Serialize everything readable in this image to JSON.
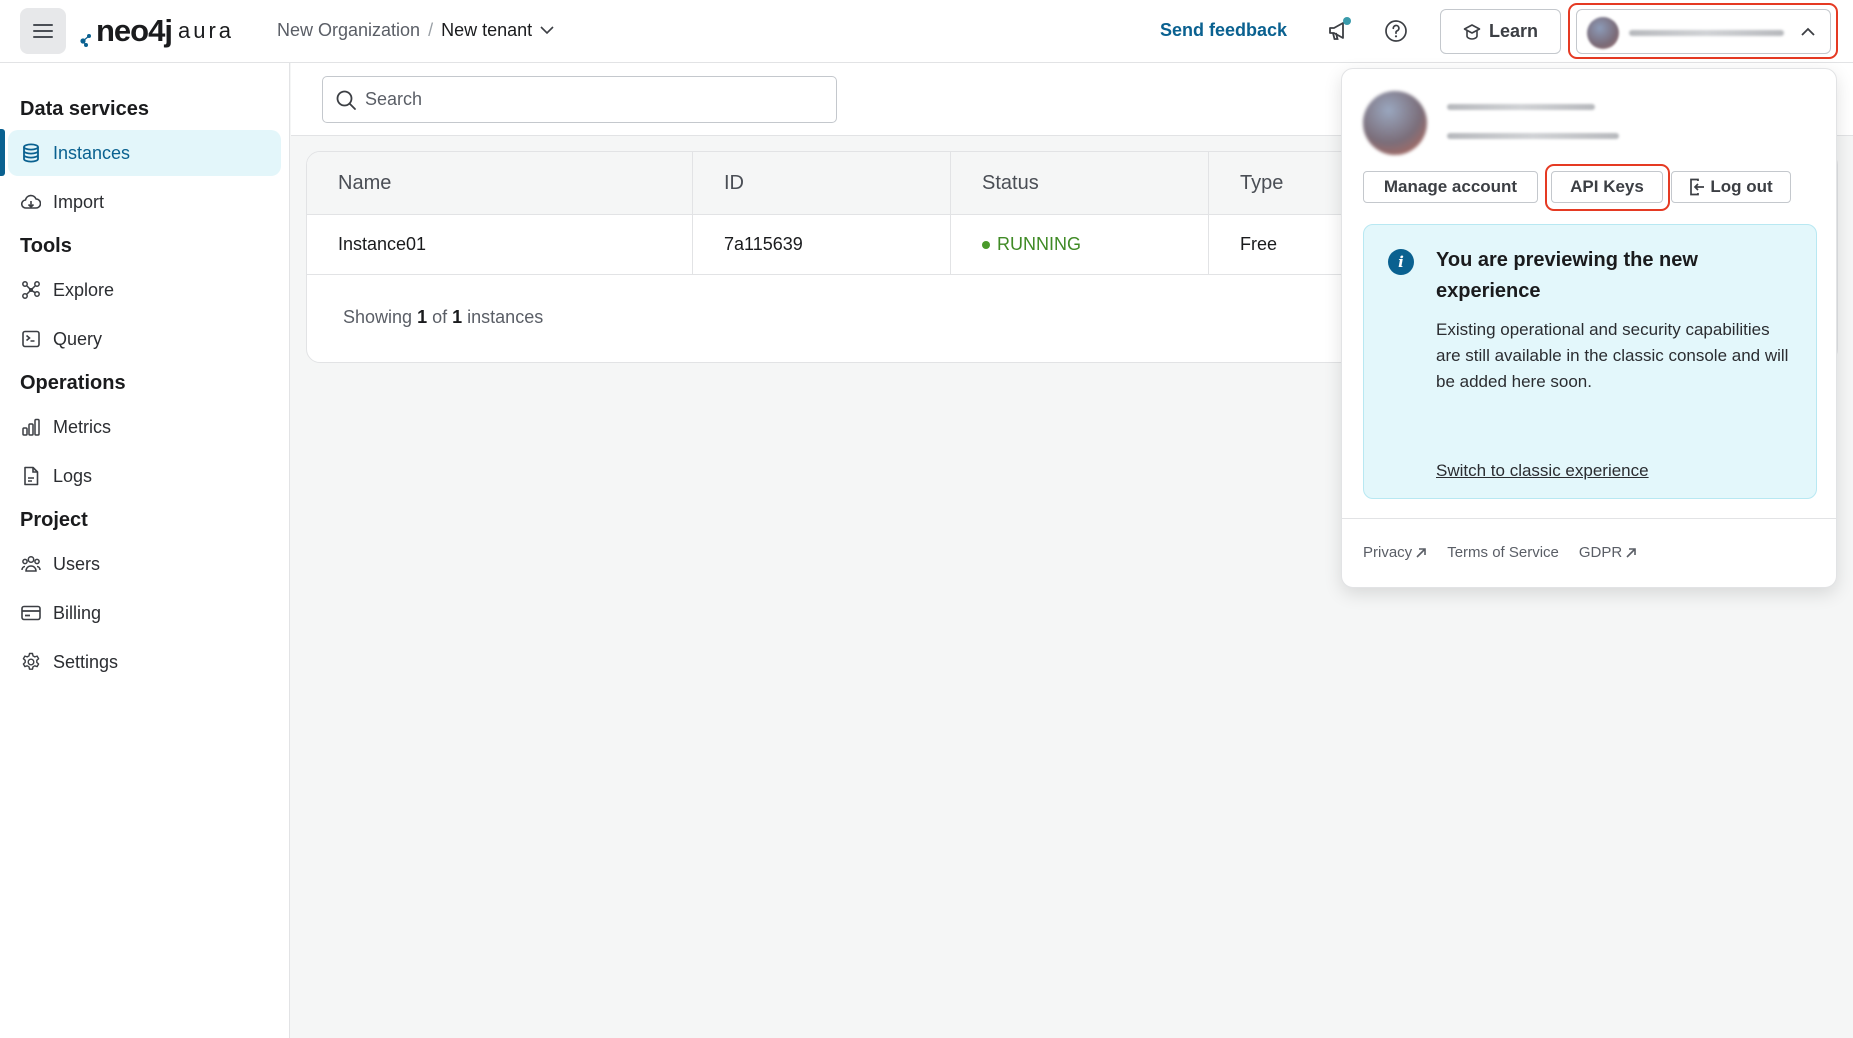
{
  "topbar": {
    "menu_icon": "hamburger-menu-icon",
    "logo_text": "neo4j",
    "logo_suffix": "aura",
    "breadcrumb": {
      "organization": "New Organization",
      "separator": "/",
      "tenant": "New tenant"
    },
    "send_feedback": "Send feedback",
    "announcements_icon": "megaphone-icon",
    "help_icon": "question-circle-icon",
    "learn_label": "Learn",
    "learn_icon": "graduation-cap-icon",
    "user_menu_expanded": true,
    "highlight_color": "#e53a23"
  },
  "sidebar": {
    "sections": [
      {
        "title": "Data services",
        "items": [
          {
            "label": "Instances",
            "icon": "database-icon",
            "active": true
          },
          {
            "label": "Import",
            "icon": "cloud-upload-icon",
            "active": false
          }
        ]
      },
      {
        "title": "Tools",
        "items": [
          {
            "label": "Explore",
            "icon": "graph-nodes-icon",
            "active": false
          },
          {
            "label": "Query",
            "icon": "terminal-icon",
            "active": false
          }
        ]
      },
      {
        "title": "Operations",
        "items": [
          {
            "label": "Metrics",
            "icon": "bar-chart-icon",
            "active": false
          },
          {
            "label": "Logs",
            "icon": "document-icon",
            "active": false
          }
        ]
      },
      {
        "title": "Project",
        "items": [
          {
            "label": "Users",
            "icon": "users-icon",
            "active": false
          },
          {
            "label": "Billing",
            "icon": "credit-card-icon",
            "active": false
          },
          {
            "label": "Settings",
            "icon": "gear-icon",
            "active": false
          }
        ]
      }
    ]
  },
  "main": {
    "search": {
      "placeholder": "Search",
      "value": ""
    },
    "table": {
      "columns": [
        "Name",
        "ID",
        "Status",
        "Type"
      ],
      "rows": [
        {
          "name": "Instance01",
          "id": "7a115639",
          "status": "RUNNING",
          "type": "Free"
        }
      ]
    },
    "footer": {
      "prefix": "Showing",
      "shown": "1",
      "of": "of",
      "total": "1",
      "suffix": "instances"
    }
  },
  "user_popover": {
    "buttons": {
      "manage_account": "Manage account",
      "api_keys": "API Keys",
      "log_out": "Log out"
    },
    "notice": {
      "title": "You are previewing the new experience",
      "body": "Existing operational and security capabilities are still available in the classic console and will be added here soon.",
      "link": "Switch to classic experience"
    },
    "footer_links": [
      {
        "label": "Privacy",
        "external": true
      },
      {
        "label": "Terms of Service",
        "external": false
      },
      {
        "label": "GDPR",
        "external": true
      }
    ]
  },
  "colors": {
    "accent": "#0a6190",
    "active_bg": "#e3f6fa",
    "running": "#3f8a25",
    "notification_dot": "#3a9bab"
  }
}
